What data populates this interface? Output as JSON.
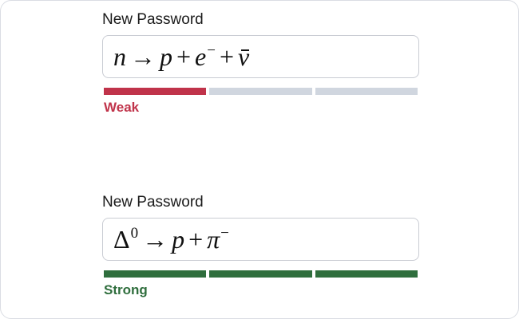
{
  "fields": [
    {
      "label": "New Password",
      "value": "n → p + e⁻ + ν̄",
      "strength": {
        "text": "Weak",
        "level": 1,
        "segments_total": 3,
        "color": "#c0334a",
        "empty_color": "#d0d6df"
      }
    },
    {
      "label": "New Password",
      "value": "Δ⁰ → p + π⁻",
      "strength": {
        "text": "Strong",
        "level": 3,
        "segments_total": 3,
        "color": "#2f6e3d",
        "empty_color": "#d0d6df"
      }
    }
  ]
}
